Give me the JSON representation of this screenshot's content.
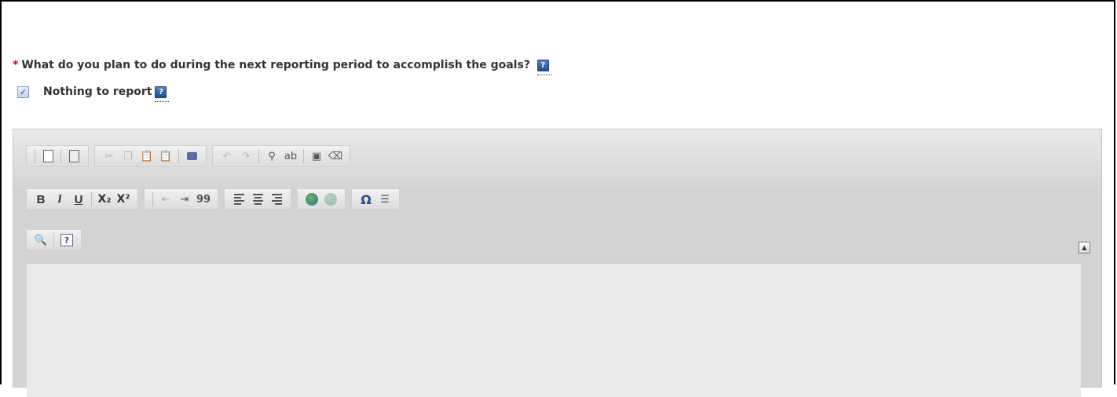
{
  "question": {
    "required_marker": "*",
    "text": "What do you plan to do during the next reporting period to accomplish the goals?",
    "help_icon": "help-icon"
  },
  "nothing_to_report": {
    "label": "Nothing to report",
    "checked": true,
    "help_icon": "help-icon"
  },
  "toolbar": {
    "row1": [
      "preview",
      "templates",
      "cut",
      "copy",
      "paste",
      "paste-from-word",
      "print",
      "undo",
      "redo",
      "find",
      "replace",
      "select-all",
      "remove-format"
    ],
    "row2": {
      "bold": "B",
      "italic": "I",
      "underline": "U",
      "subscript": "X₂",
      "superscript": "X²",
      "blockquote": "99",
      "omega": "Ω"
    },
    "row3": [
      "find-replace",
      "help"
    ]
  },
  "collapse_glyph": "▲",
  "colors": {
    "required": "#e00000",
    "editor_bg": "#d3d3d3",
    "help_icon": "#2f63a8"
  }
}
